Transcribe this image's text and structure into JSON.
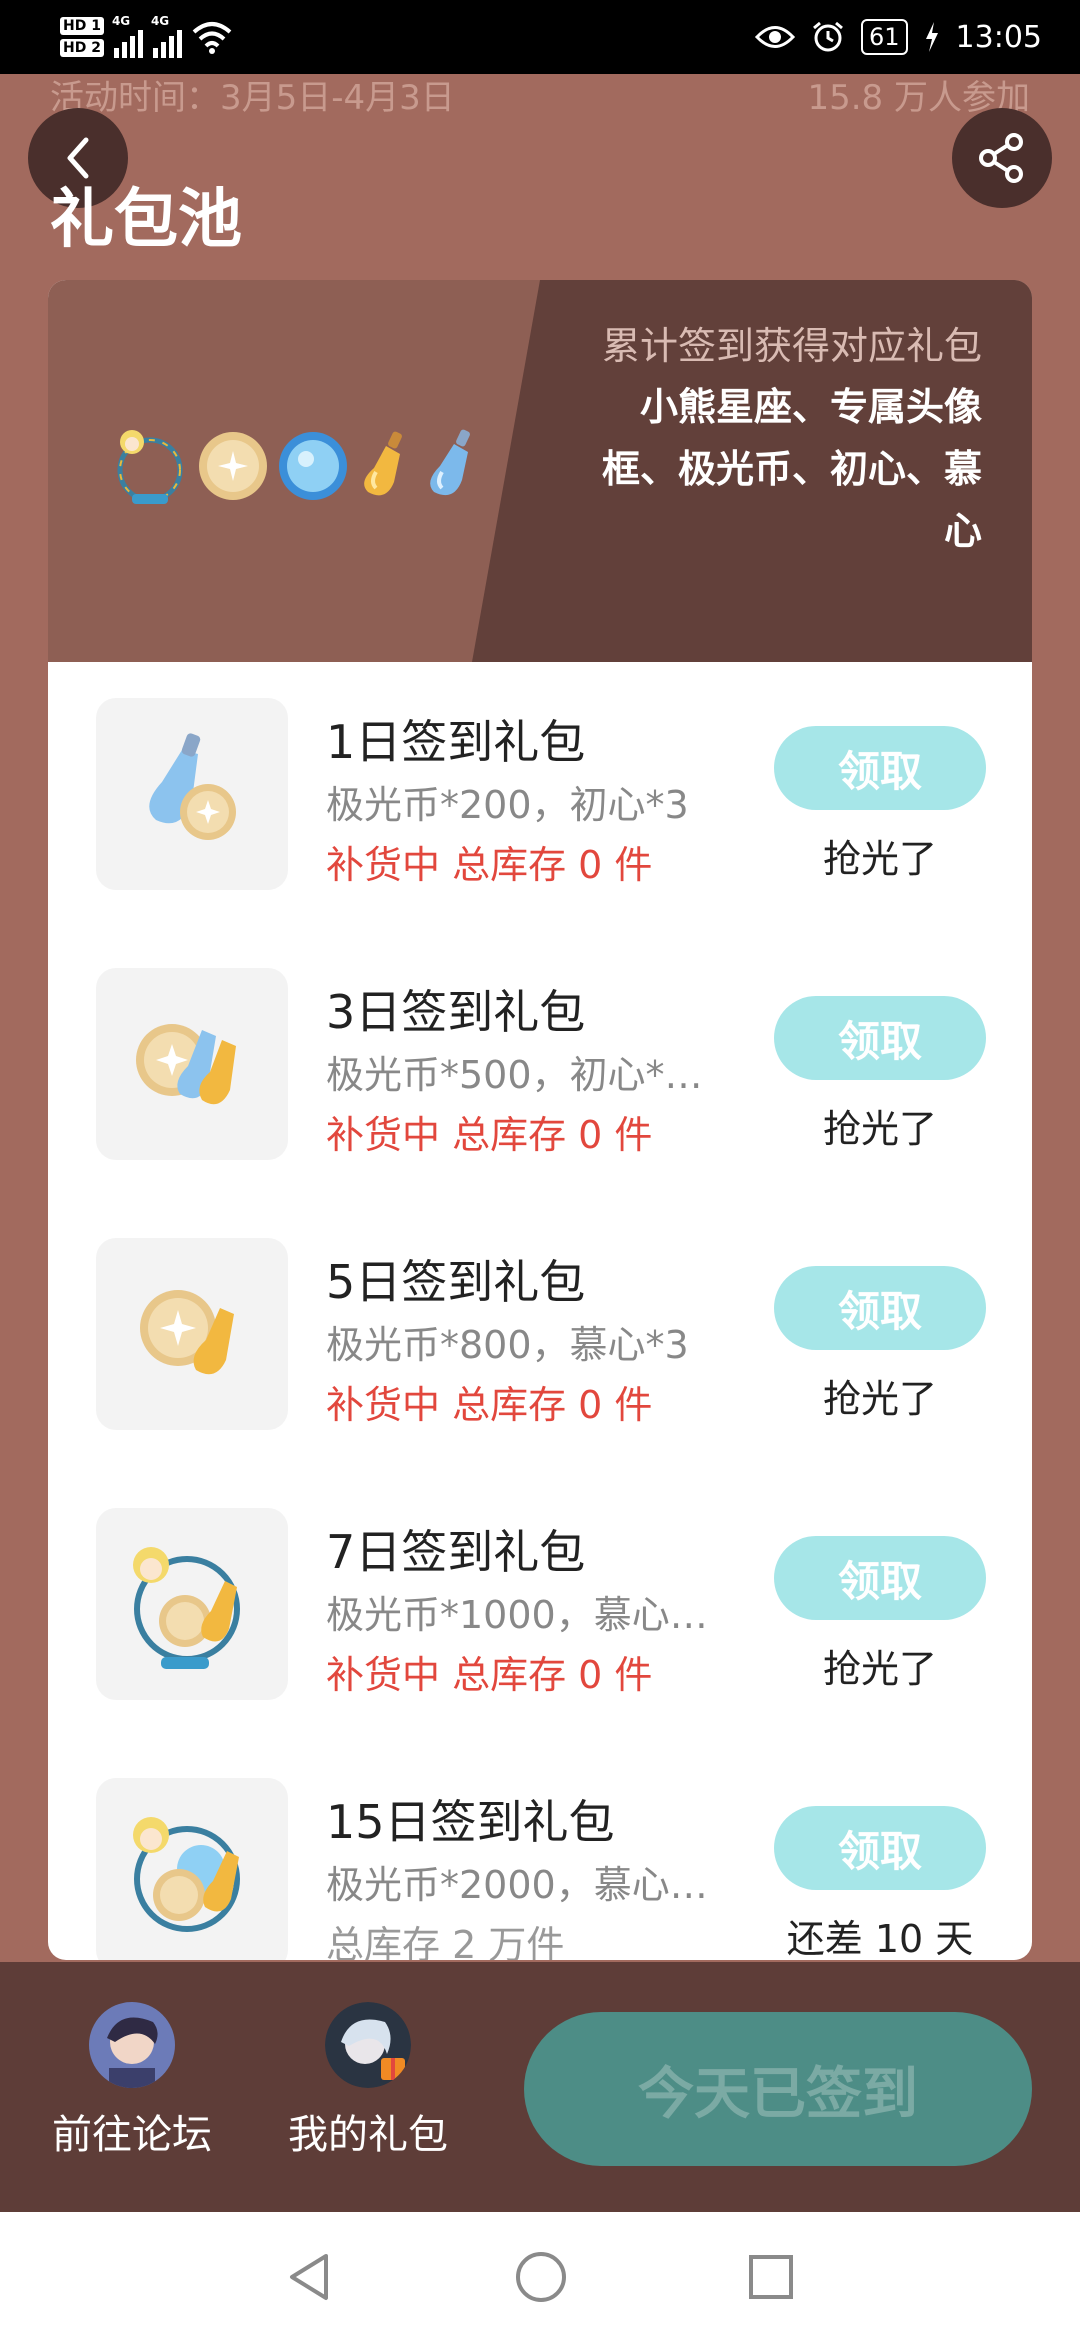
{
  "status_bar": {
    "hd1": "HD 1",
    "hd2": "HD 2",
    "net1": "4G",
    "net2": "4G",
    "battery": "61",
    "time": "13:05"
  },
  "header": {
    "activity_time": "活动时间：3月5日-4月3日",
    "participants": "15.8 万人参加",
    "title": "礼包池"
  },
  "banner": {
    "subtitle": "累计签到获得对应礼包",
    "items": "小熊星座、专属头像框、极光币、初心、慕心"
  },
  "gifts": [
    {
      "title": "1日签到礼包",
      "desc": "极光币*200，初心*3",
      "stock": "补货中 总库存 0 件",
      "button": "领取",
      "note": "抢光了"
    },
    {
      "title": "3日签到礼包",
      "desc": "极光币*500，初心*…",
      "stock": "补货中 总库存 0 件",
      "button": "领取",
      "note": "抢光了"
    },
    {
      "title": "5日签到礼包",
      "desc": "极光币*800，慕心*3",
      "stock": "补货中 总库存 0 件",
      "button": "领取",
      "note": "抢光了"
    },
    {
      "title": "7日签到礼包",
      "desc": "极光币*1000，慕心…",
      "stock": "补货中 总库存 0 件",
      "button": "领取",
      "note": "抢光了"
    },
    {
      "title": "15日签到礼包",
      "desc": "极光币*2000，慕心…",
      "stock": "总库存 2 万件",
      "button": "领取",
      "note": "还差 10 天"
    }
  ],
  "bottom_bar": {
    "forum_label": "前往论坛",
    "my_gifts_label": "我的礼包",
    "checkin_label": "今天已签到"
  },
  "colors": {
    "page_bg": "#A26A5E",
    "banner_dark": "#62403A",
    "claim_button": "#A6E6E8",
    "stock_red": "#E2473D",
    "checkin_button": "#4D8D86"
  }
}
